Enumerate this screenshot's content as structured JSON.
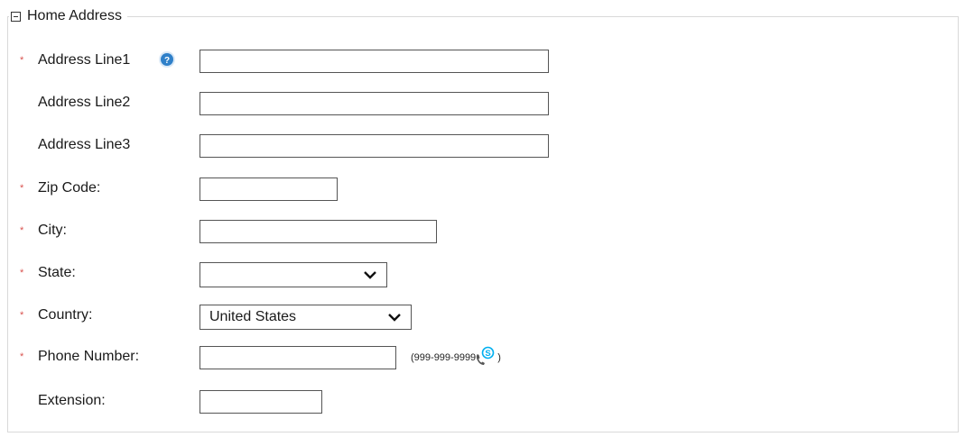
{
  "section": {
    "title": "Home Address"
  },
  "fields": {
    "address_line1": {
      "label": "Address Line1",
      "required_mark": "*",
      "value": ""
    },
    "address_line2": {
      "label": "Address Line2",
      "value": ""
    },
    "address_line3": {
      "label": "Address Line3",
      "value": ""
    },
    "zip_code": {
      "label": "Zip Code:",
      "required_mark": "*",
      "value": ""
    },
    "city": {
      "label": "City:",
      "required_mark": "*",
      "value": ""
    },
    "state": {
      "label": "State:",
      "required_mark": "*",
      "selected": ""
    },
    "country": {
      "label": "Country:",
      "required_mark": "*",
      "selected": "United States"
    },
    "phone_number": {
      "label": "Phone Number:",
      "required_mark": "*",
      "value": "",
      "format_open": "(",
      "format": "999-999-9999",
      "format_close": ")"
    },
    "extension": {
      "label": "Extension:",
      "value": ""
    }
  },
  "icons": {
    "help": "help-icon",
    "phone": "phone-icon",
    "skype": "skype-icon",
    "collapse": "collapse-icon",
    "dropdown": "chevron-down-icon"
  },
  "colors": {
    "required": "#d9534f",
    "help": "#2f80c9",
    "skype": "#00aff0",
    "border": "#d9d9d9"
  }
}
